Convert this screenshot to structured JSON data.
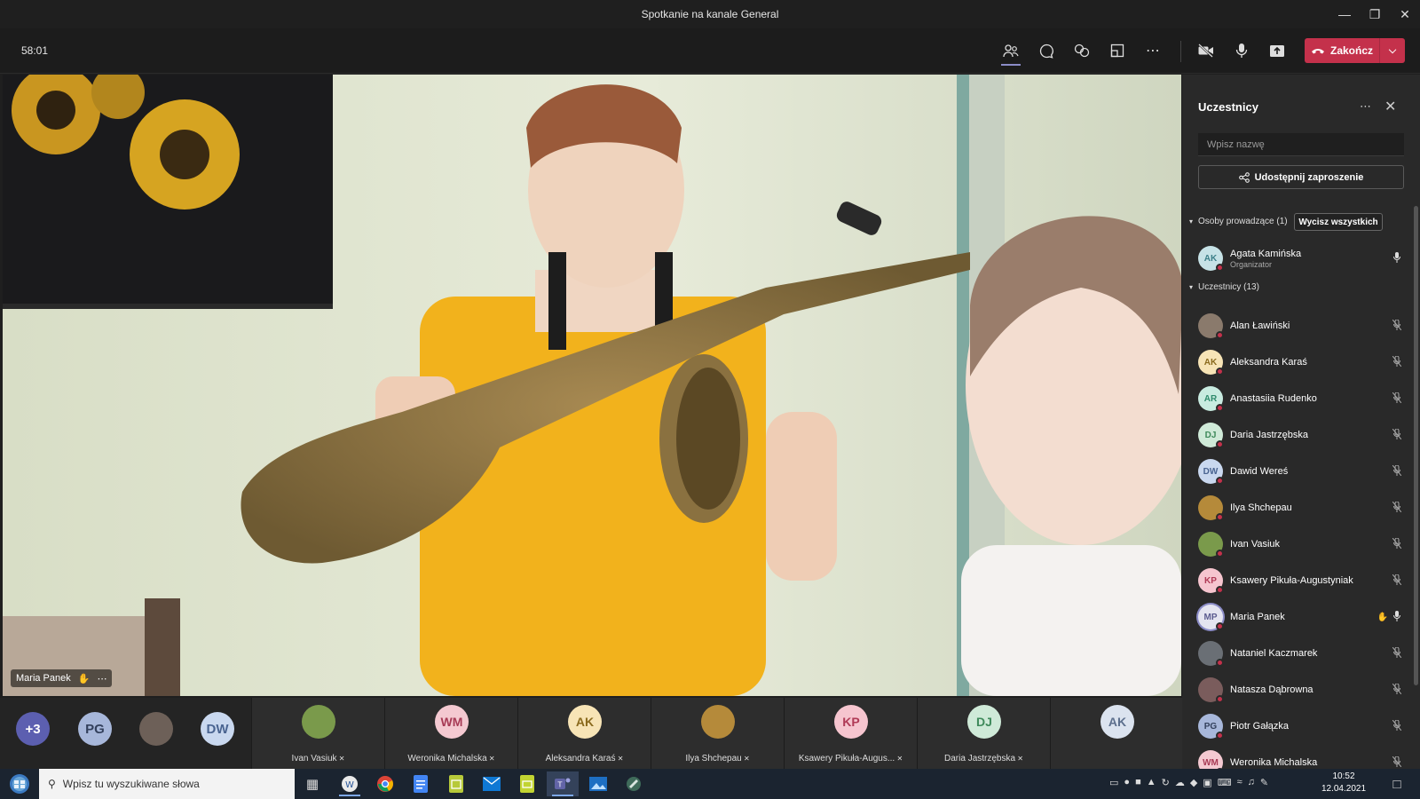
{
  "window": {
    "title": "Spotkanie na kanale General"
  },
  "toolbar": {
    "timer": "58:01",
    "end_label": "Zakończ"
  },
  "stage": {
    "speaker_name": "Maria Panek"
  },
  "strip": {
    "overflow": "+3",
    "mini": [
      {
        "initials": "PG",
        "bg": "#a7b7da",
        "fg": "#33405c"
      },
      {
        "initials": "",
        "bg": "#6d6058",
        "fg": "#fff"
      },
      {
        "initials": "DW",
        "bg": "#c9d8ef",
        "fg": "#4a6491"
      }
    ],
    "tiles": [
      {
        "initials": "",
        "name": "Ivan Vasiuk",
        "bg": "#7a9a4b",
        "fg": "#fff"
      },
      {
        "initials": "WM",
        "name": "Weronika Michalska",
        "bg": "#f4c9d1",
        "fg": "#a73a55"
      },
      {
        "initials": "AK",
        "name": "Aleksandra Karaś",
        "bg": "#f7e4b6",
        "fg": "#8a6a1d"
      },
      {
        "initials": "",
        "name": "Ilya Shchepau",
        "bg": "#b58a3a",
        "fg": "#fff"
      },
      {
        "initials": "KP",
        "name": "Ksawery Pikuła-Augus...",
        "bg": "#f6c5cf",
        "fg": "#b03a56"
      },
      {
        "initials": "DJ",
        "name": "Daria Jastrzębska",
        "bg": "#cfead8",
        "fg": "#3f8a5b"
      },
      {
        "initials": "AK",
        "name": "",
        "bg": "#dbe3ef",
        "fg": "#5c6f8d"
      }
    ]
  },
  "panel": {
    "title": "Uczestnicy",
    "search_placeholder": "Wpisz nazwę",
    "share_label": "Udostępnij zaproszenie",
    "presenters_header": "Osoby prowadzące (1)",
    "mute_all_label": "Wycisz wszystkich",
    "attendees_header": "Uczestnicy (13)",
    "presenters": [
      {
        "initials": "AK",
        "name": "Agata Kamińska",
        "role": "Organizator",
        "bg": "#c6e2e6",
        "fg": "#3c7f88"
      }
    ],
    "attendees": [
      {
        "initials": "",
        "name": "Alan Ławiński",
        "bg": "#8a7a6c",
        "fg": "#fff"
      },
      {
        "initials": "AK",
        "name": "Aleksandra Karaś",
        "bg": "#f7e4b6",
        "fg": "#8a6a1d"
      },
      {
        "initials": "AR",
        "name": "Anastasiia Rudenko",
        "bg": "#c8ebe0",
        "fg": "#2f8a6c"
      },
      {
        "initials": "DJ",
        "name": "Daria Jastrzębska",
        "bg": "#cfead8",
        "fg": "#3f8a5b"
      },
      {
        "initials": "DW",
        "name": "Dawid Wereś",
        "bg": "#c9d8ef",
        "fg": "#4a6491"
      },
      {
        "initials": "",
        "name": "Ilya Shchepau",
        "bg": "#b58a3a",
        "fg": "#fff"
      },
      {
        "initials": "",
        "name": "Ivan Vasiuk",
        "bg": "#7a9a4b",
        "fg": "#fff"
      },
      {
        "initials": "KP",
        "name": "Ksawery Pikuła-Augustyniak",
        "bg": "#f6c5cf",
        "fg": "#b03a56"
      },
      {
        "initials": "MP",
        "name": "Maria Panek",
        "bg": "#e4e4f0",
        "fg": "#5b5b8f"
      },
      {
        "initials": "",
        "name": "Nataniel Kaczmarek",
        "bg": "#6a6f75",
        "fg": "#fff"
      },
      {
        "initials": "",
        "name": "Natasza Dąbrowna",
        "bg": "#7a5c5c",
        "fg": "#fff"
      },
      {
        "initials": "PG",
        "name": "Piotr Gałązka",
        "bg": "#a7b7da",
        "fg": "#33405c"
      },
      {
        "initials": "WM",
        "name": "Weronika Michalska",
        "bg": "#f4c9d1",
        "fg": "#a73a55"
      }
    ]
  },
  "taskbar": {
    "search_placeholder": "Wpisz tu wyszukiwane słowa",
    "time": "10:52",
    "date": "12.04.2021"
  }
}
